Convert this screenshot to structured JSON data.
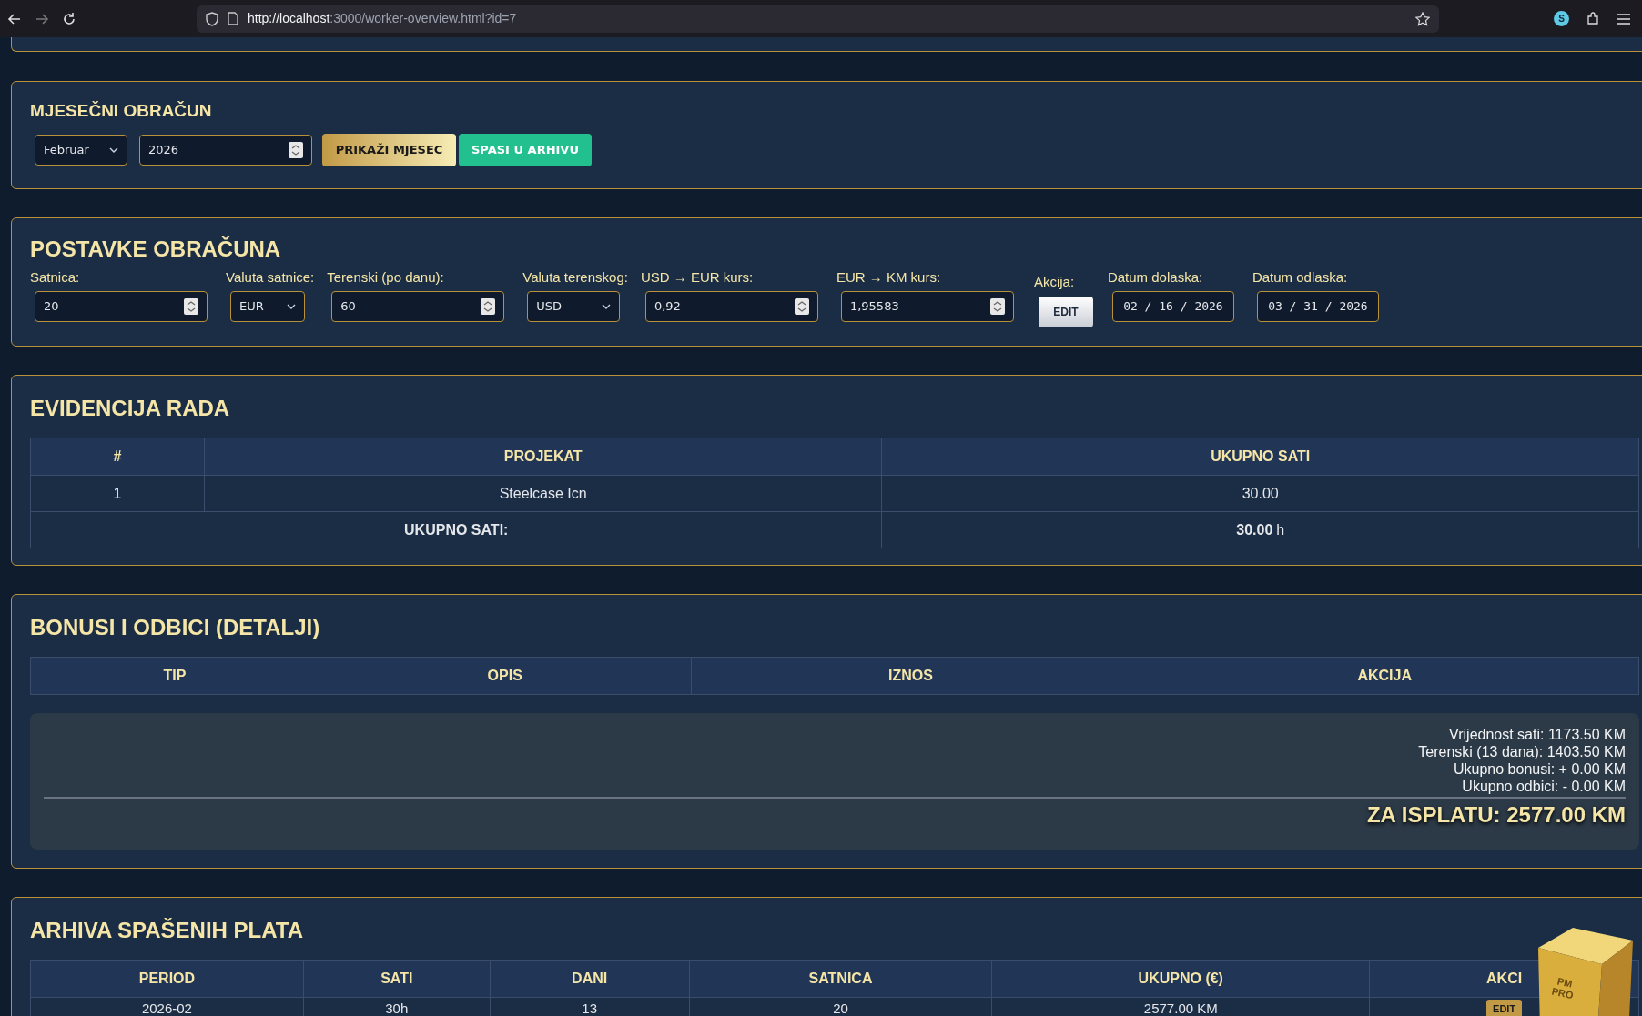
{
  "browser": {
    "url_host": "http://localhost",
    "url_rest": ":3000/worker-overview.html?id=7",
    "profile_letter": "S"
  },
  "monthly": {
    "title": "MJESEČNI OBRAČUN",
    "month": "Februar",
    "year": "2026",
    "buttons": [
      {
        "label": "PRIKAŽI MJESEC",
        "kind": "gold"
      },
      {
        "label": "SPASI U ARHIVU",
        "kind": "green"
      }
    ]
  },
  "settings": {
    "title": "POSTAVKE OBRAČUNA",
    "fields": [
      {
        "label": "Satnica:",
        "kind": "number",
        "value": "20"
      },
      {
        "label": "Valuta satnice:",
        "kind": "select",
        "value": "EUR"
      },
      {
        "label": "Terenski (po danu):",
        "kind": "number",
        "value": "60"
      },
      {
        "label": "Valuta terenskog:",
        "kind": "select",
        "value": "USD"
      },
      {
        "label": "USD → EUR kurs:",
        "kind": "number",
        "value": "0,92"
      },
      {
        "label": "EUR → KM kurs:",
        "kind": "number",
        "value": "1,95583"
      },
      {
        "label": "Akcija:",
        "kind": "button",
        "value": "EDIT"
      },
      {
        "label": "Datum dolaska:",
        "kind": "date",
        "value": "02 / 16 / 2026"
      },
      {
        "label": "Datum odlaska:",
        "kind": "date",
        "value": "03 / 31 / 2026"
      }
    ]
  },
  "work": {
    "title": "EVIDENCIJA RADA",
    "columns": [
      "#",
      "PROJEKAT",
      "UKUPNO SATI"
    ],
    "rows": [
      [
        "1",
        "Steelcase Icn",
        "30.00"
      ]
    ],
    "total_label": "UKUPNO SATI:",
    "total_value": "30.00",
    "total_unit": "h"
  },
  "bonuses": {
    "title": "BONUSI I ODBICI (DETALJI)",
    "columns": [
      "TIP",
      "OPIS",
      "IZNOS",
      "AKCIJA"
    ],
    "summary": [
      "Vrijednost sati: 1173.50 KM",
      "Terenski (13 dana): 1403.50 KM",
      "Ukupno bonusi: + 0.00 KM",
      "Ukupno odbici: - 0.00 KM"
    ],
    "payout": "ZA ISPLATU: 2577.00 KM"
  },
  "archive": {
    "title": "ARHIVA SPAŠENIH PLATA",
    "columns": [
      "PERIOD",
      "SATI",
      "DANI",
      "SATNICA",
      "UKUPNO (€)",
      "AKCI"
    ],
    "rows": [
      {
        "cells": [
          "2026-02",
          "30h",
          "13",
          "20",
          "2577.00 KM"
        ],
        "action": "EDIT"
      }
    ]
  },
  "logo": {
    "line1": "PM",
    "line2": "PRO"
  }
}
